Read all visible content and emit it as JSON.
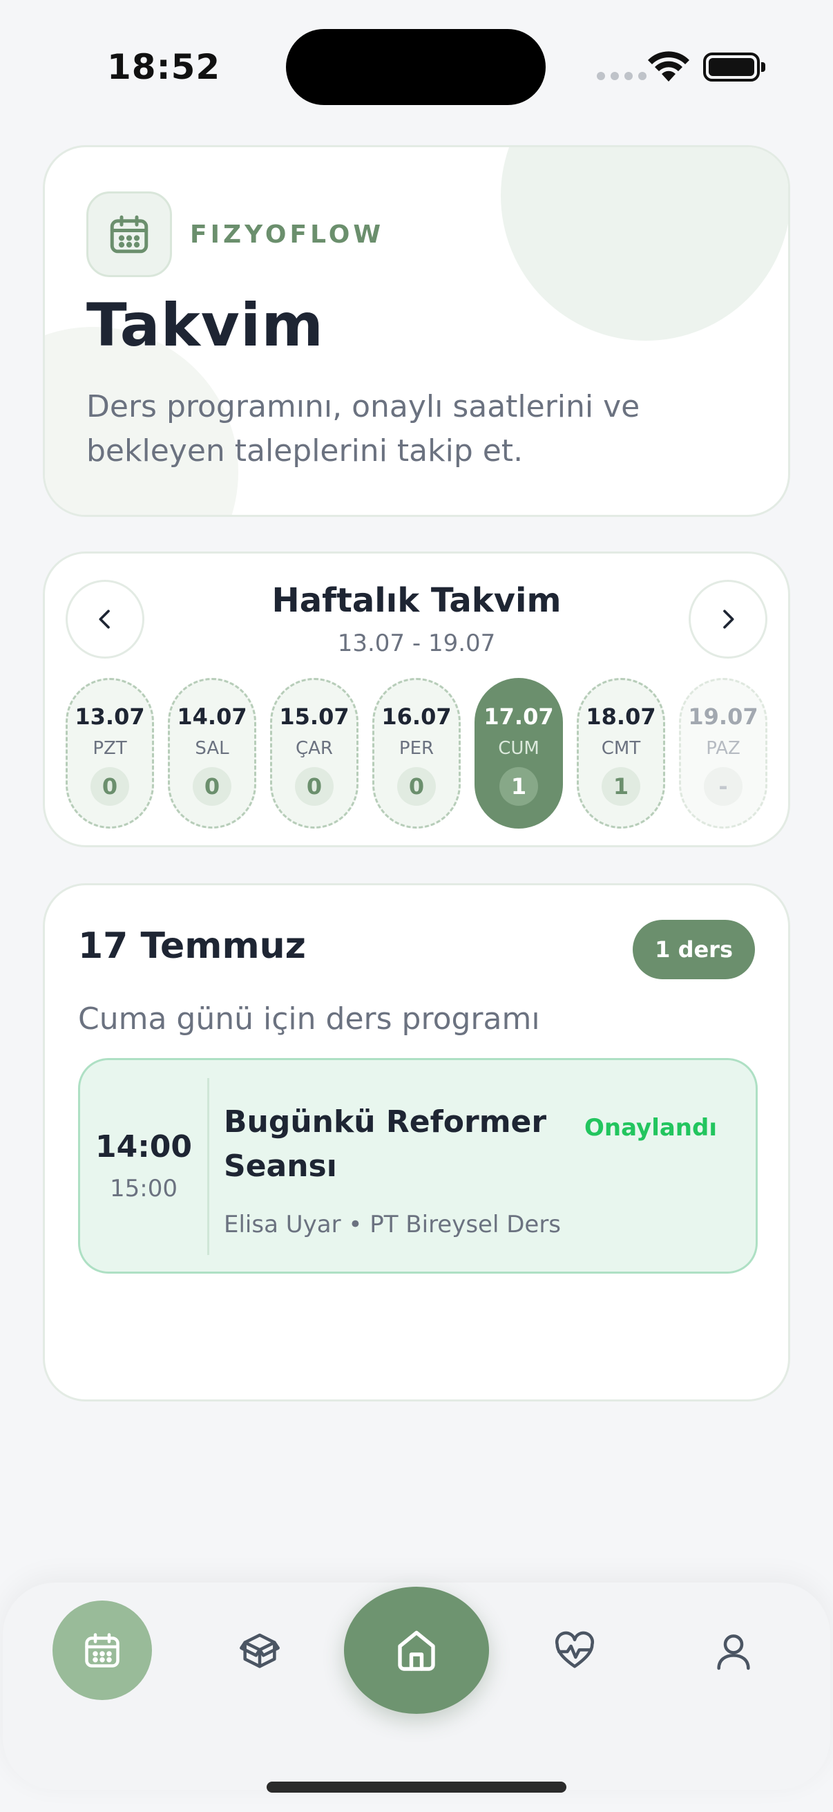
{
  "status_bar": {
    "time": "18:52"
  },
  "hero": {
    "brand": "FIZYOFLOW",
    "title": "Takvim",
    "subtitle": "Ders programını, onaylı saatlerini ve bekleyen taleplerini takip et.",
    "icon": "calendar-icon"
  },
  "week": {
    "title": "Haftalık Takvim",
    "range": "13.07 - 19.07",
    "days": [
      {
        "date": "13.07",
        "name": "PZT",
        "count": "0",
        "state": "default"
      },
      {
        "date": "14.07",
        "name": "SAL",
        "count": "0",
        "state": "default"
      },
      {
        "date": "15.07",
        "name": "ÇAR",
        "count": "0",
        "state": "default"
      },
      {
        "date": "16.07",
        "name": "PER",
        "count": "0",
        "state": "default"
      },
      {
        "date": "17.07",
        "name": "CUM",
        "count": "1",
        "state": "active"
      },
      {
        "date": "18.07",
        "name": "CMT",
        "count": "1",
        "state": "default"
      },
      {
        "date": "19.07",
        "name": "PAZ",
        "count": "-",
        "state": "muted"
      }
    ]
  },
  "schedule": {
    "title": "17 Temmuz",
    "badge": "1 ders",
    "subtitle": "Cuma günü için ders programı",
    "lessons": [
      {
        "start": "14:00",
        "end": "15:00",
        "title": "Bugünkü Reformer Seansı",
        "status": "Onaylandı",
        "meta": "Elisa Uyar • PT Bireysel Ders"
      }
    ]
  },
  "tabbar": {
    "items": [
      "calendar-icon",
      "box-icon",
      "home-icon",
      "heart-pulse-icon",
      "user-icon"
    ],
    "active": "calendar-icon"
  },
  "colors": {
    "accent": "#6b8f6d",
    "accent_light": "#99bb99",
    "status_green": "#22c55e",
    "lesson_bg": "#e8f6ee"
  }
}
